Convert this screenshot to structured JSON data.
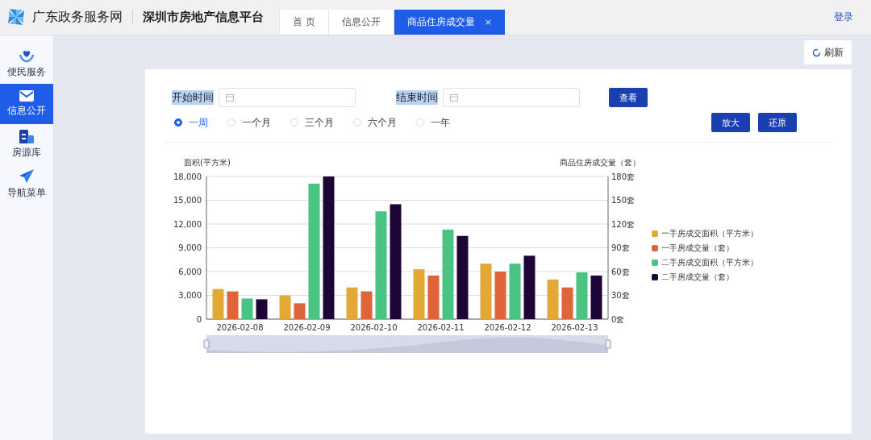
{
  "header": {
    "site_name": "广东政务服务网",
    "platform_name": "深圳市房地产信息平台",
    "login": "登录"
  },
  "tabs": [
    {
      "label": "首 页",
      "selected": false
    },
    {
      "label": "信息公开",
      "selected": false
    },
    {
      "label": "商品住房成交量",
      "selected": true,
      "close": "×"
    }
  ],
  "sidebar": {
    "items": [
      {
        "label": "便民服务",
        "selected": false
      },
      {
        "label": "信息公开",
        "selected": true
      },
      {
        "label": "房源库",
        "selected": false
      },
      {
        "label": "导航菜单",
        "selected": false
      }
    ]
  },
  "refresh_button": "刷新",
  "form": {
    "start_label": "开始时间",
    "end_label": "结束时间",
    "query_button": "查看",
    "zoom_button": "放大",
    "reset_button": "还原",
    "ranges": [
      {
        "label": "一周",
        "selected": true
      },
      {
        "label": "一个月",
        "selected": false
      },
      {
        "label": "三个月",
        "selected": false
      },
      {
        "label": "六个月",
        "selected": false
      },
      {
        "label": "一年",
        "selected": false
      }
    ]
  },
  "chart_data": {
    "type": "bar",
    "stacked": false,
    "grid": true,
    "ylabel": "面积(平方米)",
    "y2label": "商品住房成交量（套）",
    "categories": [
      "2026-02-08",
      "2026-02-09",
      "2026-02-10",
      "2026-02-11",
      "2026-02-12",
      "2026-02-13"
    ],
    "ylim": [
      0,
      18000
    ],
    "y2lim": [
      0,
      180
    ],
    "yticks": [
      {
        "value": 0,
        "label": "0"
      },
      {
        "value": 3000,
        "label": "3,000"
      },
      {
        "value": 6000,
        "label": "6,000"
      },
      {
        "value": 9000,
        "label": "9,000"
      },
      {
        "value": 12000,
        "label": "12,000"
      },
      {
        "value": 15000,
        "label": "15,000"
      },
      {
        "value": 18000,
        "label": "18,000"
      }
    ],
    "y2ticks": [
      {
        "value": 0,
        "label": "0套"
      },
      {
        "value": 30,
        "label": "30套"
      },
      {
        "value": 60,
        "label": "60套"
      },
      {
        "value": 90,
        "label": "90套"
      },
      {
        "value": 120,
        "label": "120套"
      },
      {
        "value": 150,
        "label": "150套"
      },
      {
        "value": 180,
        "label": "180套"
      }
    ],
    "series": [
      {
        "name": "一手房成交面积（平方米）",
        "color": "#e3a937",
        "values": [
          3800,
          3000,
          4000,
          6300,
          7000,
          5000
        ]
      },
      {
        "name": "一手房成交量（套）",
        "color": "#e0643a",
        "axis": "y2",
        "values": [
          35,
          20,
          35,
          55,
          60,
          40
        ]
      },
      {
        "name": "二手房成交面积（平方米）",
        "color": "#4ac483",
        "values": [
          2600,
          17100,
          13600,
          11300,
          7000,
          5900
        ]
      },
      {
        "name": "二手房成交量（套）",
        "color": "#1d0538",
        "axis": "y2",
        "values": [
          25,
          180,
          145,
          105,
          80,
          55
        ]
      }
    ]
  }
}
